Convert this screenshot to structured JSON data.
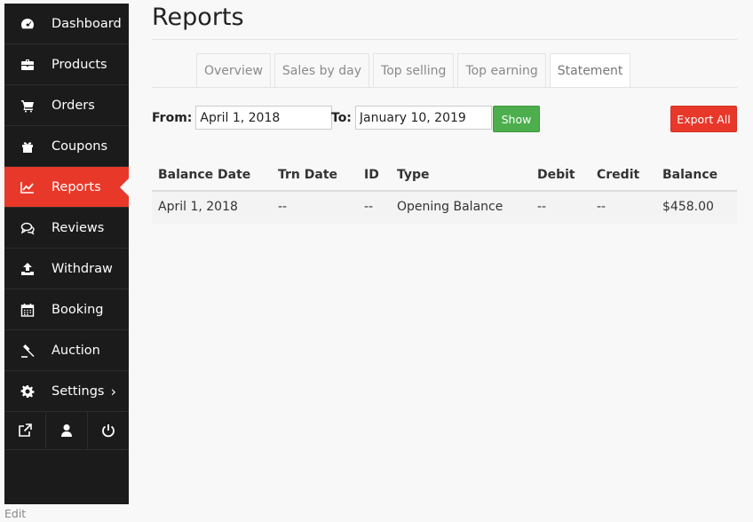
{
  "sidebar": {
    "items": [
      {
        "label": "Dashboard",
        "icon": "dashboard-icon"
      },
      {
        "label": "Products",
        "icon": "briefcase-icon"
      },
      {
        "label": "Orders",
        "icon": "cart-icon"
      },
      {
        "label": "Coupons",
        "icon": "gift-icon"
      },
      {
        "label": "Reports",
        "icon": "line-chart-icon",
        "active": true
      },
      {
        "label": "Reviews",
        "icon": "comments-icon"
      },
      {
        "label": "Withdraw",
        "icon": "upload-icon"
      },
      {
        "label": "Booking",
        "icon": "calendar-icon"
      },
      {
        "label": "Auction",
        "icon": "gavel-icon"
      },
      {
        "label": "Settings",
        "icon": "gear-icon",
        "chevron": "›"
      }
    ],
    "bottom_icons": [
      "external-link-icon",
      "user-icon",
      "power-icon"
    ],
    "edit_label": "Edit"
  },
  "page": {
    "title": "Reports"
  },
  "tabs": [
    {
      "label": "Overview"
    },
    {
      "label": "Sales by day"
    },
    {
      "label": "Top selling"
    },
    {
      "label": "Top earning"
    },
    {
      "label": "Statement",
      "active": true
    }
  ],
  "filter": {
    "from_label": "From:",
    "from_value": "April 1, 2018",
    "to_label": "To:",
    "to_value": "January 10, 2019",
    "show_label": "Show",
    "export_label": "Export All"
  },
  "table": {
    "headers": [
      "Balance Date",
      "Trn Date",
      "ID",
      "Type",
      "Debit",
      "Credit",
      "Balance"
    ],
    "rows": [
      [
        "April 1, 2018",
        "--",
        "--",
        "Opening Balance",
        "--",
        "--",
        "$458.00"
      ]
    ]
  },
  "colors": {
    "sidebar_bg": "#1b1b1b",
    "accent": "#e8382a",
    "show_button": "#4cae4c"
  }
}
